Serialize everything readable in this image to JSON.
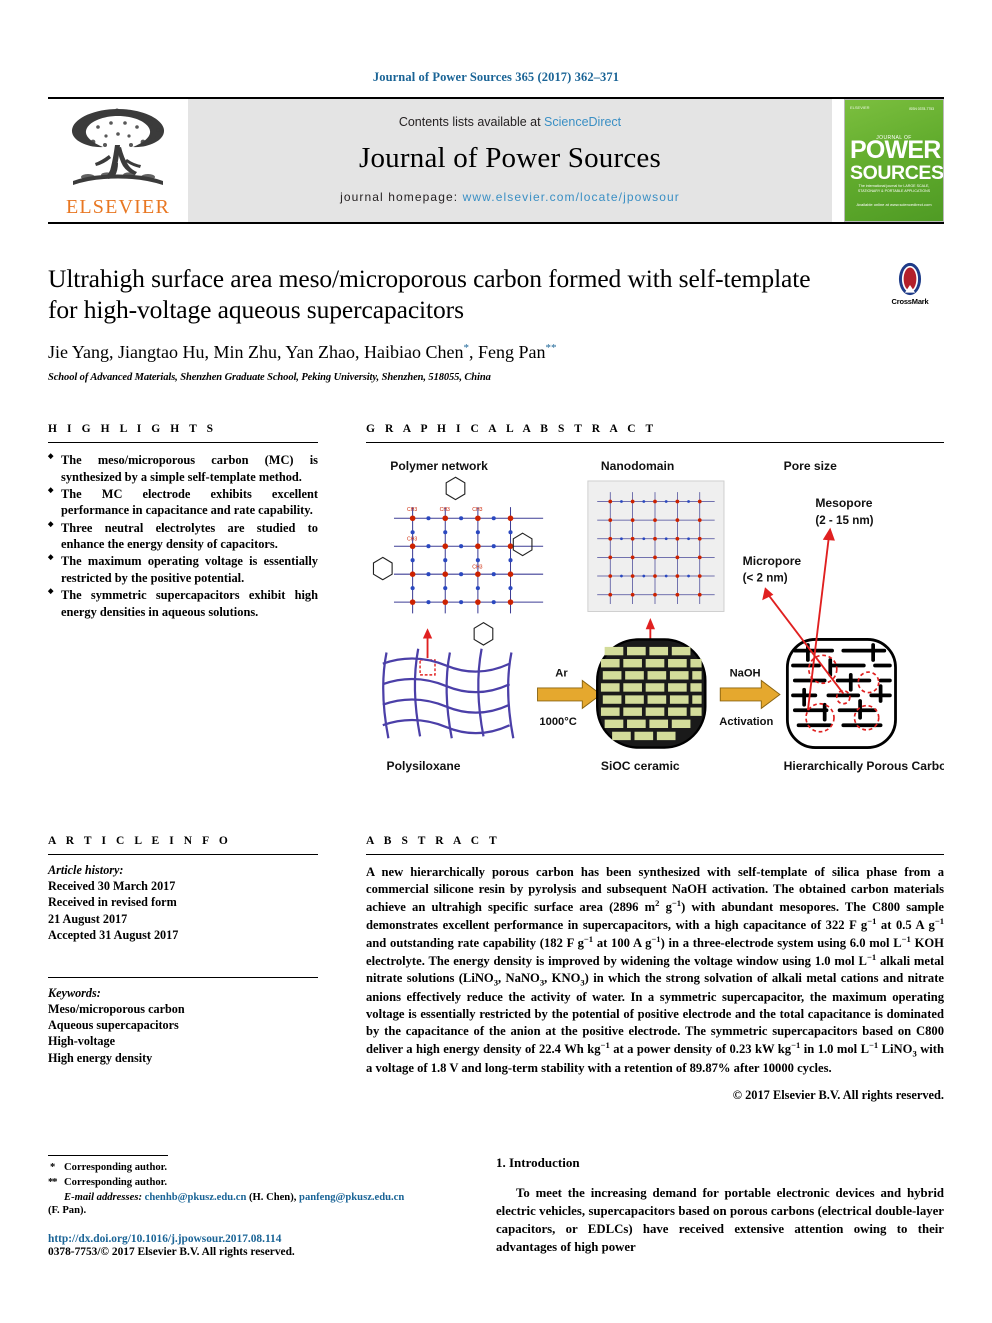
{
  "running_head": "Journal of Power Sources 365 (2017) 362–371",
  "masthead": {
    "contents_prefix": "Contents lists available at ",
    "sciencedirect": "ScienceDirect",
    "journal_name": "Journal of Power Sources",
    "homepage_label": "journal homepage: ",
    "homepage_url": "www.elsevier.com/locate/jpowsour",
    "elsevier_wordmark": "ELSEVIER",
    "cover": {
      "publisher": "ELSEVIER",
      "issn": "ISSN 0378-7753",
      "jof": "JOURNAL OF",
      "power": "POWER",
      "sources": "SOURCES",
      "subtitle": "The international journal for\nLARGE SCALE, STATIONARY & PORTABLE APPLICATIONS",
      "footer": "Available online at\nwww.sciencedirect.com"
    }
  },
  "article": {
    "title": "Ultrahigh surface area meso/microporous carbon formed with self-template for high-voltage aqueous supercapacitors",
    "authors_plain": "Jie Yang, Jiangtao Hu, Min Zhu, Yan Zhao, Haibiao Chen",
    "author_mark_1": "*",
    "authors_last": ", Feng Pan",
    "author_mark_2": "**",
    "affiliation": "School of Advanced Materials, Shenzhen Graduate School, Peking University, Shenzhen, 518055, China",
    "crossmark_label": "CrossMark"
  },
  "highlights": {
    "heading": "H I G H L I G H T S",
    "items": [
      "The meso/microporous carbon (MC) is synthesized by a simple self-template method.",
      "The MC electrode exhibits excellent performance in capacitance and rate capability.",
      "Three neutral electrolytes are studied to enhance the energy density of capacitors.",
      "The maximum operating voltage is essentially restricted by the positive potential.",
      "The symmetric supercapacitors exhibit high energy densities in aqueous solutions."
    ]
  },
  "graphical_abstract": {
    "heading": "G R A P H I C A L   A B S T R A C T",
    "labels": {
      "polymer_network": "Polymer network",
      "nanodomain": "Nanodomain",
      "pore_size": "Pore size",
      "mesopore": "Mesopore",
      "mesopore_range": "(2 - 15 nm)",
      "micropore": "Micropore",
      "micropore_range": "(< 2 nm)",
      "arrow1_top": "Ar",
      "arrow1_bottom": "1000°C",
      "arrow2_top": "NaOH",
      "arrow2_bottom": "Activation",
      "stage1": "Polysiloxane",
      "stage2": "SiOC ceramic",
      "stage3": "Hierarchically Porous Carbon"
    }
  },
  "article_info": {
    "heading": "A R T I C L E   I N F O",
    "history_label": "Article history:",
    "history": [
      "Received 30 March 2017",
      "Received in revised form",
      "21 August 2017",
      "Accepted 31 August 2017"
    ],
    "keywords_label": "Keywords:",
    "keywords": [
      "Meso/microporous carbon",
      "Aqueous supercapacitors",
      "High-voltage",
      "High energy density"
    ]
  },
  "abstract": {
    "heading": "A B S T R A C T",
    "copyright": "© 2017 Elsevier B.V. All rights reserved."
  },
  "footnotes": {
    "mark1": "*",
    "corresponding1": "Corresponding author.",
    "mark2": "**",
    "corresponding2": "Corresponding author.",
    "email_label": "E-mail addresses:",
    "email1": "chenhb@pkusz.edu.cn",
    "email1_person": "(H. Chen),",
    "email2": "panfeng@pkusz.edu.cn",
    "email2_person": "(F. Pan).",
    "doi": "http://dx.doi.org/10.1016/j.jpowsour.2017.08.114",
    "issn_line": "0378-7753/© 2017 Elsevier B.V. All rights reserved."
  },
  "introduction": {
    "heading": "1. Introduction",
    "paragraph": "To meet the increasing demand for portable electronic devices and hybrid electric vehicles, supercapacitors based on porous carbons (electrical double-layer capacitors, or EDLCs) have received extensive attention owing to their advantages of high power"
  },
  "colors": {
    "link": "#1a6496",
    "elsevier_orange": "#E87722",
    "cover_green": "#63ad2e",
    "masthead_grey": "#e4e4e4",
    "diagram_arrow": "#E5A82E",
    "diagram_mesh": "#4b3fa8",
    "diagram_brick": "#d3dc9a",
    "diagram_pore": "#e02020"
  }
}
